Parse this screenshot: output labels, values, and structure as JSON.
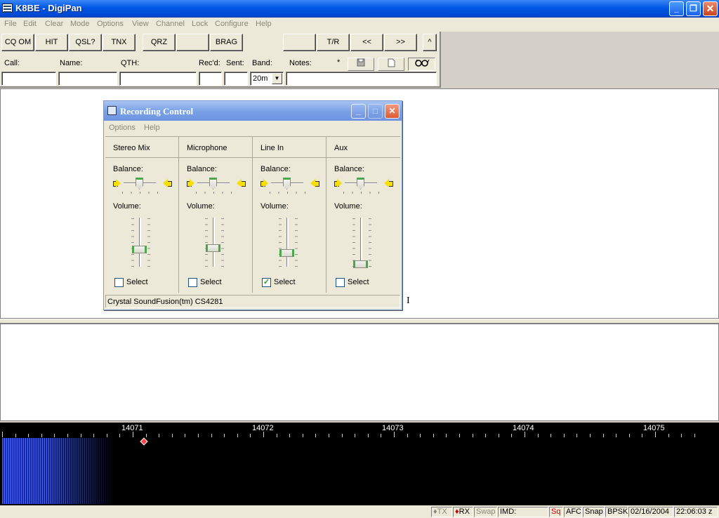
{
  "window": {
    "title": "K8BE - DigiPan",
    "minimize": "_",
    "restore": "❐",
    "close": "✕"
  },
  "menu": [
    "File",
    "Edit",
    "Clear",
    "Mode",
    "Options",
    "View",
    "Channel",
    "Lock",
    "Configure",
    "Help"
  ],
  "toolbar": {
    "buttons": [
      "CQ OM",
      "HIT",
      "QSL?",
      "TNX",
      "QRZ",
      "",
      "BRAG",
      "",
      "T/R",
      "<<",
      ">>",
      "^"
    ],
    "fields": {
      "call": "Call:",
      "name": "Name:",
      "qth": "QTH:",
      "recd": "Rec'd:",
      "sent": "Sent:",
      "band": "Band:",
      "notes": "Notes:",
      "star": "*"
    },
    "band_value": "20m",
    "icons": [
      "save-icon",
      "page-icon",
      "glasses-icon"
    ]
  },
  "recording_control": {
    "title": "Recording Control",
    "menu": [
      "Options",
      "Help"
    ],
    "balance_label": "Balance:",
    "volume_label": "Volume:",
    "select_label": "Select",
    "channels": [
      {
        "name": "Stereo Mix",
        "selected": false,
        "volume": 0.38
      },
      {
        "name": "Microphone",
        "selected": false,
        "volume": 0.41
      },
      {
        "name": "Line In",
        "selected": true,
        "volume": 0.3
      },
      {
        "name": "Aux",
        "selected": false,
        "volume": 0.05
      }
    ],
    "device": "Crystal SoundFusion(tm) CS4281"
  },
  "waterfall": {
    "freqs": [
      "14071",
      "14072",
      "14073",
      "14074",
      "14075"
    ]
  },
  "status": {
    "tx": "TX",
    "rx": "RX",
    "swap": "Swap",
    "imd": "IMD:",
    "sq": "Sq",
    "afc": "AFC",
    "snap": "Snap",
    "mode": "BPSK",
    "date": "02/16/2004",
    "time": "22:06:03 z"
  }
}
